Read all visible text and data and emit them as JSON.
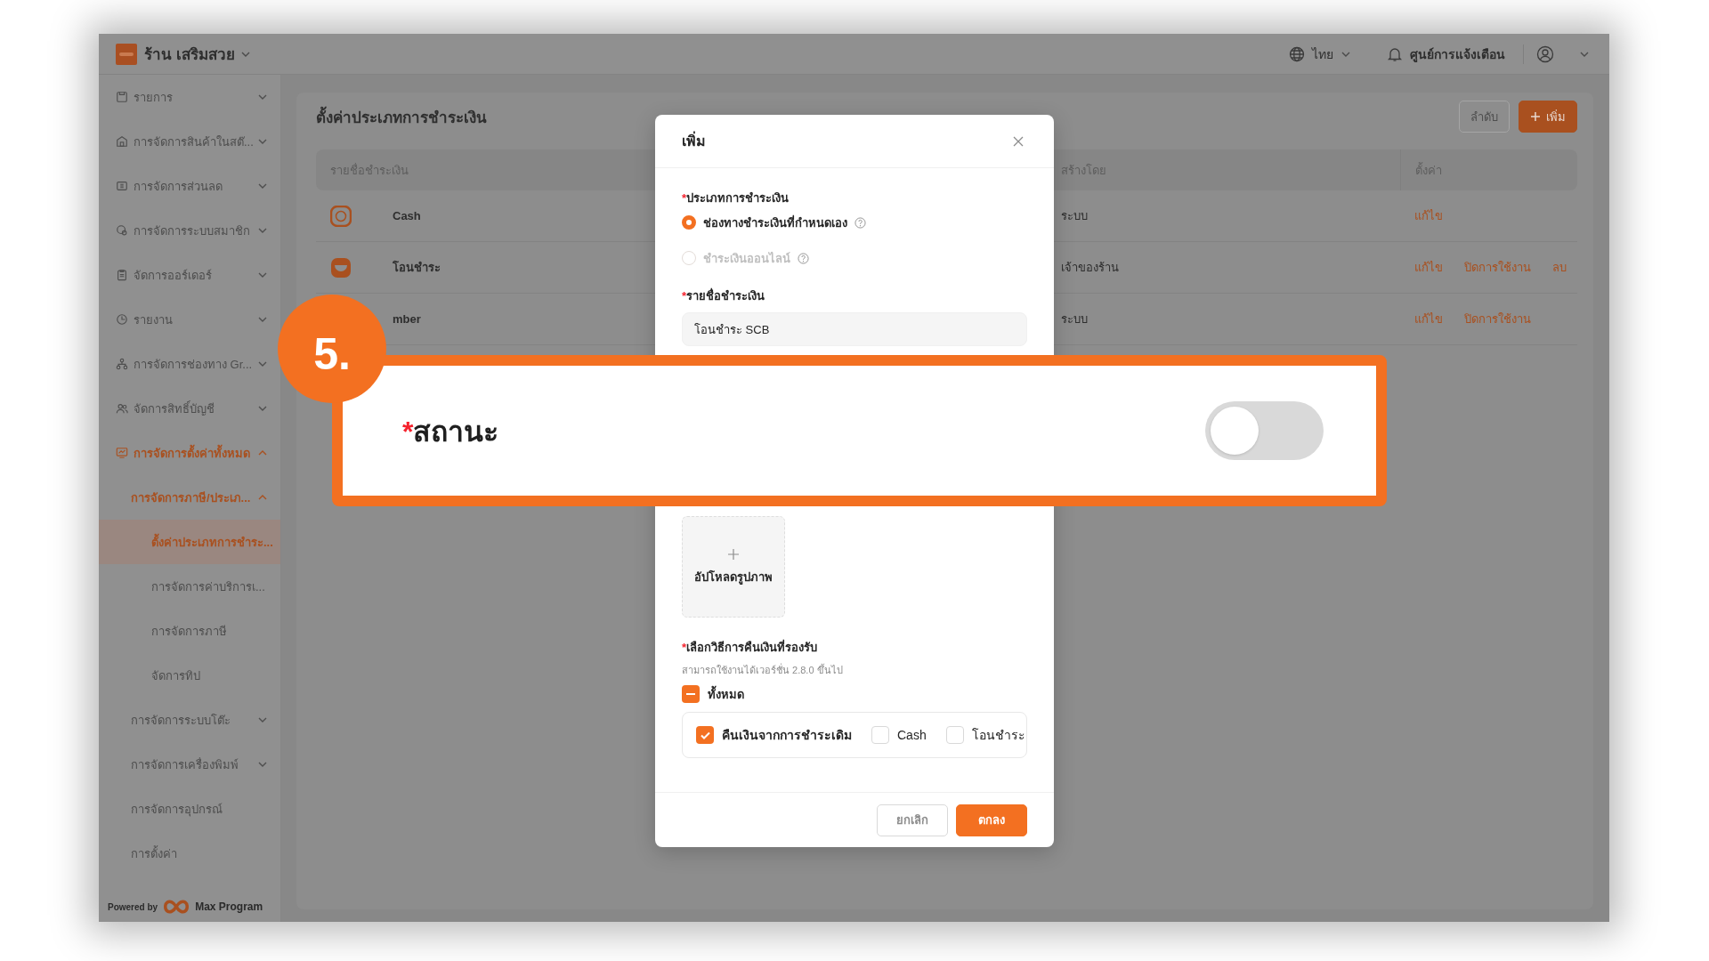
{
  "topbar": {
    "store_name": "ร้าน เสริมสวย",
    "language": "ไทย",
    "notifications": "ศูนย์การแจ้งเตือน"
  },
  "sidebar": {
    "items": [
      {
        "label": "รายการ",
        "expanded": false,
        "selected": false
      },
      {
        "label": "การจัดการสินค้าในสต๊...",
        "expanded": false,
        "selected": false
      },
      {
        "label": "การจัดการส่วนลด",
        "expanded": false,
        "selected": false
      },
      {
        "label": "การจัดการระบบสมาชิก",
        "expanded": false,
        "selected": false
      },
      {
        "label": "จัดการออร์เดอร์",
        "expanded": false,
        "selected": false
      },
      {
        "label": "รายงาน",
        "expanded": false,
        "selected": false
      },
      {
        "label": "การจัดการช่องทาง Gr...",
        "expanded": false,
        "selected": false
      },
      {
        "label": "จัดการสิทธิ์บัญชี",
        "expanded": false,
        "selected": false
      },
      {
        "label": "การจัดการตั้งค่าทั้งหมด",
        "expanded": true,
        "selected": false,
        "children": [
          {
            "label": "การจัดการภาษี/ประเภ...",
            "expanded": true,
            "selected": false,
            "children": [
              {
                "label": "ตั้งค่าประเภทการชำระ...",
                "selected": true
              },
              {
                "label": "การจัดการค่าบริการเ...",
                "selected": false
              },
              {
                "label": "การจัดการภาษี",
                "selected": false
              },
              {
                "label": "จัดการทิป",
                "selected": false
              }
            ]
          },
          {
            "label": "การจัดการระบบโต๊ะ",
            "expanded": false,
            "selected": false
          },
          {
            "label": "การจัดการเครื่องพิมพ์",
            "expanded": false,
            "selected": false
          },
          {
            "label": "การจัดการอุปกรณ์",
            "selected": false
          },
          {
            "label": "การตั้งค่า",
            "selected": false
          }
        ]
      }
    ],
    "footer": {
      "powered_by": "Powered by",
      "brand": "Max Program"
    }
  },
  "page": {
    "title": "ตั้งค่าประเภทการชำระเงิน",
    "buttons": [
      {
        "label": "ลำดับ",
        "kind": "outline"
      },
      {
        "label": "เพิ่ม",
        "kind": "primary"
      }
    ],
    "table": {
      "columns": [
        {
          "label": "รายชื่อชำระเงิน"
        },
        {
          "label": "สร้างโดย"
        },
        {
          "label": "ตั้งค่า"
        }
      ],
      "rows": [
        {
          "name": "Cash",
          "created_by": "ระบบ",
          "actions": [
            "แก้ไข"
          ]
        },
        {
          "name": "โอนชำระ",
          "created_by": "เจ้าของร้าน",
          "actions": [
            "แก้ไข",
            "ปิดการใช้งาน",
            "ลบ"
          ]
        },
        {
          "name": "mber",
          "created_by": "ระบบ",
          "actions": [
            "แก้ไข",
            "ปิดการใช้งาน"
          ]
        }
      ]
    }
  },
  "modal": {
    "title": "เพิ่ม",
    "payment_type": {
      "required_mark": "*",
      "label": "ประเภทการชำระเงิน",
      "options": [
        {
          "label": "ช่องทางชำระเงินที่กำหนดเอง",
          "selected": true,
          "disabled": false,
          "help": true
        },
        {
          "label": "ชำระเงินออนไลน์",
          "selected": false,
          "disabled": true,
          "help": true
        }
      ]
    },
    "payment_name": {
      "required_mark": "*",
      "label": "รายชื่อชำระเงิน",
      "value": "โอนชำระ SCB"
    },
    "upload": {
      "label": "อัปโหลดรูปภาพ"
    },
    "refund": {
      "required_mark": "*",
      "label": "เลือกวิธีการคืนเงินที่รองรับ",
      "hint": "สามารถใช้งานได้เวอร์ชั่น 2.8.0 ขึ้นไป",
      "select_all": {
        "label": "ทั้งหมด",
        "indeterminate": true
      },
      "options": [
        {
          "label": "คืนเงินจากการชำระเดิม",
          "checked": true
        },
        {
          "label": "Cash",
          "checked": false
        },
        {
          "label": "โอนชำระ",
          "checked": false
        }
      ]
    },
    "buttons": [
      {
        "label": "ยกเลิก",
        "kind": "outline"
      },
      {
        "label": "ตกลง",
        "kind": "primary"
      }
    ]
  },
  "callout": {
    "step": "5.",
    "required_mark": "*",
    "label": "สถานะ",
    "toggle": {
      "on": false
    }
  }
}
